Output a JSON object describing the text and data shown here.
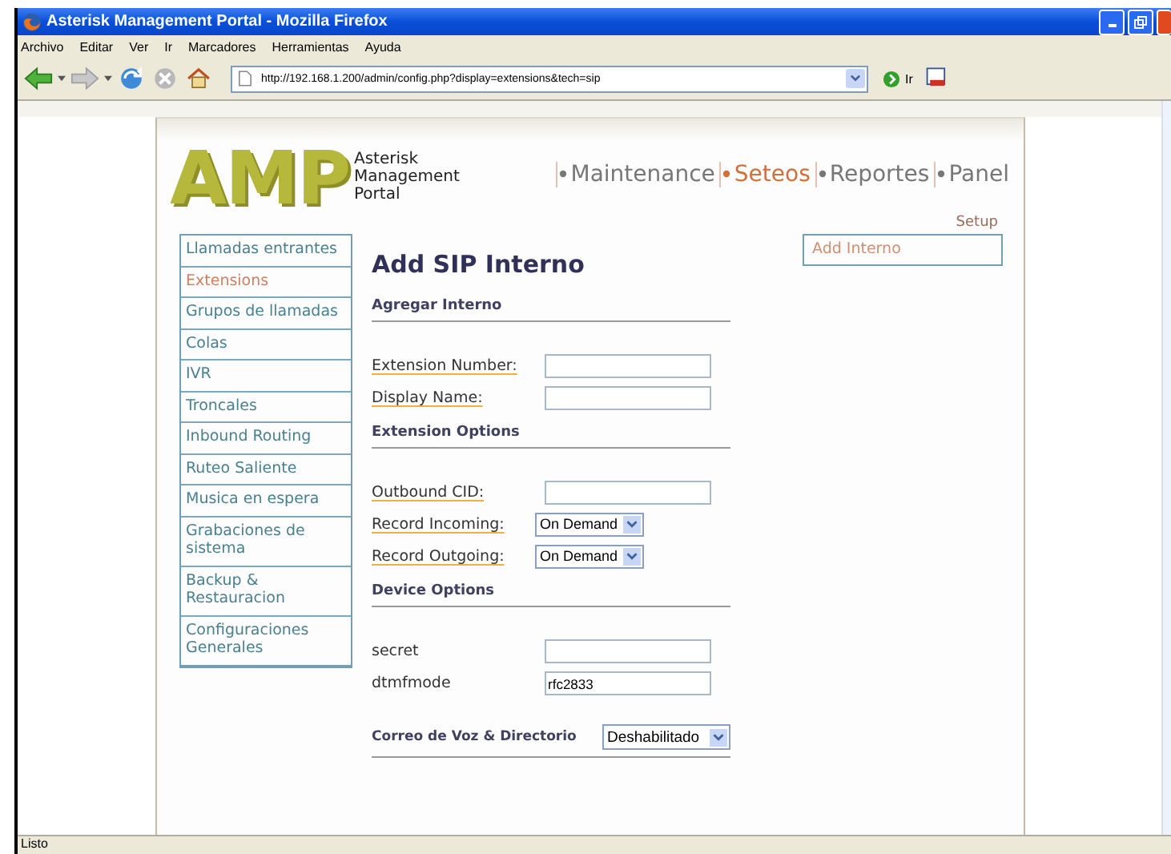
{
  "window": {
    "title": "Asterisk Management Portal - Mozilla Firefox"
  },
  "menu": [
    "Archivo",
    "Editar",
    "Ver",
    "Ir",
    "Marcadores",
    "Herramientas",
    "Ayuda"
  ],
  "toolbar": {
    "url": "http://192.168.1.200/admin/config.php?display=extensions&tech=sip",
    "go": "Ir"
  },
  "header": {
    "logo": "AMP",
    "portal_name": "Asterisk Management Portal",
    "setup": "Setup"
  },
  "nav": [
    {
      "label": "Maintenance",
      "selected": false
    },
    {
      "label": "Seteos",
      "selected": true
    },
    {
      "label": "Reportes",
      "selected": false
    },
    {
      "label": "Panel",
      "selected": false
    }
  ],
  "sidebar": {
    "items": [
      {
        "label": "Llamadas entrantes",
        "selected": false
      },
      {
        "label": "Extensions",
        "selected": true
      },
      {
        "label": "Grupos de llamadas",
        "selected": false
      },
      {
        "label": "Colas",
        "selected": false
      },
      {
        "label": "IVR",
        "selected": false
      },
      {
        "label": "Troncales",
        "selected": false
      },
      {
        "label": "Inbound Routing",
        "selected": false
      },
      {
        "label": "Ruteo Saliente",
        "selected": false
      },
      {
        "label": "Musica en espera",
        "selected": false
      },
      {
        "label": "Grabaciones de sistema",
        "selected": false
      },
      {
        "label": "Backup & Restauracion",
        "selected": false
      },
      {
        "label": "Configuraciones Generales",
        "selected": false
      }
    ]
  },
  "right_panel": {
    "items": [
      {
        "label": "Add Interno",
        "selected": true
      }
    ]
  },
  "form": {
    "title": "Add SIP Interno",
    "sections": [
      {
        "title": "Agregar Interno",
        "fields": [
          {
            "kind": "text",
            "label": "Extension Number:",
            "help": true
          },
          {
            "kind": "text",
            "label": "Display Name:",
            "help": true
          }
        ]
      },
      {
        "title": "Extension Options",
        "fields": [
          {
            "kind": "text",
            "label": "Outbound CID:",
            "help": true
          },
          {
            "kind": "select",
            "label": "Record Incoming:",
            "help": true,
            "value": "On Demand"
          },
          {
            "kind": "select",
            "label": "Record Outgoing:",
            "help": true,
            "value": "On Demand"
          }
        ]
      },
      {
        "title": "Device Options",
        "fields": [
          {
            "kind": "text",
            "label": "secret",
            "help": false
          },
          {
            "kind": "text",
            "label": "dtmfmode",
            "help": false,
            "value": "rfc2833"
          }
        ]
      }
    ],
    "voicemail": {
      "label": "Correo de Voz & Directorio",
      "value": "Deshabilitado"
    }
  },
  "status_bar": {
    "text": "Listo"
  }
}
